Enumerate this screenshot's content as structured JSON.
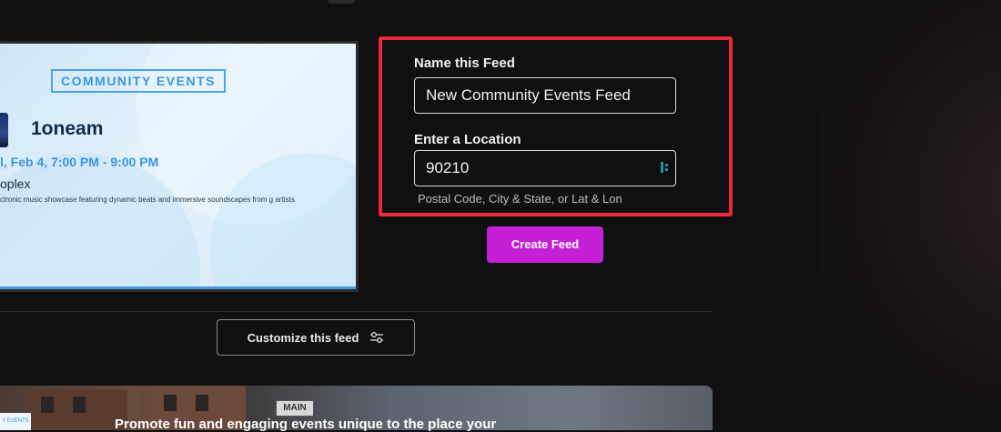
{
  "preview": {
    "badge": "COMMUNITY EVENTS",
    "event_title": "1oneam",
    "event_date": "l, Feb 4, 7:00 PM - 9:00 PM",
    "event_venue": "oplex",
    "event_description": "ctronic music showcase featuring dynamic beats and immersive soundscapes from g artists."
  },
  "form": {
    "name_label": "Name this Feed",
    "name_value": "New Community Events Feed",
    "location_label": "Enter a Location",
    "location_value": "90210",
    "location_hint": "Postal Code, City & State, or Lat & Lon",
    "create_button": "Create Feed",
    "highlight_color": "#ea2a3b"
  },
  "customize": {
    "button_label": "Customize this feed",
    "icon": "sliders-icon"
  },
  "promo": {
    "text": "Promote fun and engaging events unique to the place your",
    "sign_text": "MAIN",
    "badge_text": "Y EVENTS"
  },
  "colors": {
    "accent": "#c520d6",
    "background": "#111010",
    "event_blue": "#3a95e0"
  }
}
